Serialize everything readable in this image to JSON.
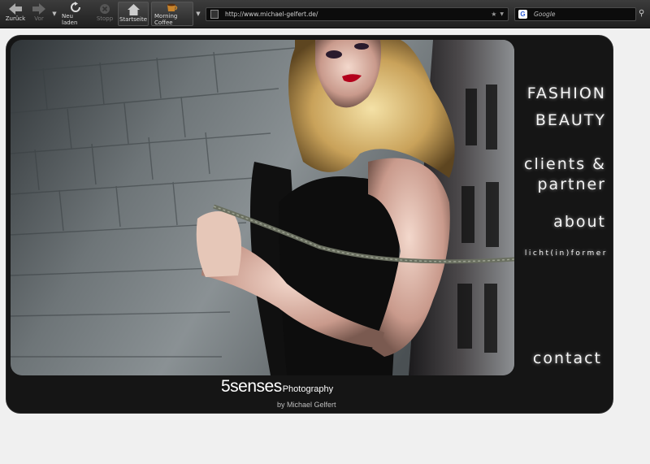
{
  "toolbar": {
    "back": "Zurück",
    "forward": "Vor",
    "reload": "Neu laden",
    "stop": "Stopp",
    "home": "Startseite",
    "bookmark": "Morning Coffee",
    "url": "http://www.michael-gelfert.de/",
    "search_placeholder": "Google"
  },
  "menu": {
    "fashion": "FASHION",
    "beauty": "BEAUTY",
    "clients1": "clients &",
    "clients2": "partner",
    "about": "about",
    "lichtformer": "licht(in)former",
    "contact": "contact"
  },
  "brand": {
    "name": "5senses",
    "photography": "Photography",
    "by": "by Michael Gelfert"
  },
  "colors": {
    "panel": "#151515",
    "page_bg": "#f0f0f0",
    "lip": "#b3001b"
  }
}
